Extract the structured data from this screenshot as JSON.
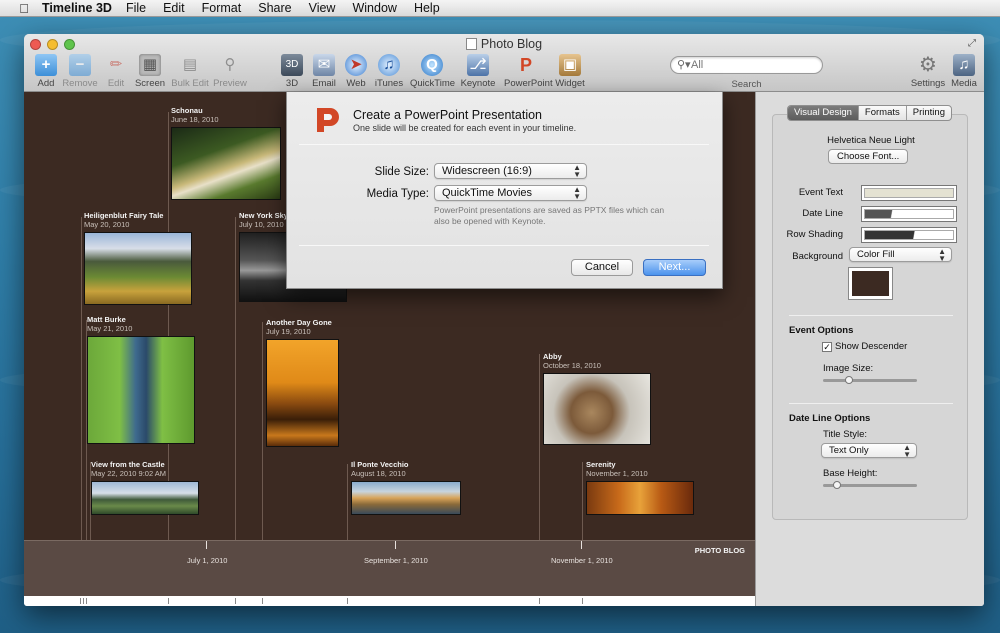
{
  "menubar": {
    "app_name": "Timeline 3D",
    "items": [
      "File",
      "Edit",
      "Format",
      "Share",
      "View",
      "Window",
      "Help"
    ]
  },
  "window": {
    "title": "Photo Blog"
  },
  "toolbar": {
    "buttons": [
      {
        "label": "Add",
        "icon": "plus-icon"
      },
      {
        "label": "Remove",
        "icon": "minus-icon"
      },
      {
        "label": "Edit",
        "icon": "pencil-icon"
      },
      {
        "label": "Screen",
        "icon": "screen-icon"
      },
      {
        "label": "Bulk Edit",
        "icon": "bulk-edit-icon"
      },
      {
        "label": "Preview",
        "icon": "preview-icon"
      },
      {
        "label": "3D",
        "icon": "3d-icon"
      },
      {
        "label": "Email",
        "icon": "email-icon"
      },
      {
        "label": "Web",
        "icon": "web-icon"
      },
      {
        "label": "iTunes",
        "icon": "itunes-icon"
      },
      {
        "label": "QuickTime",
        "icon": "quicktime-icon"
      },
      {
        "label": "Keynote",
        "icon": "keynote-icon"
      },
      {
        "label": "PowerPoint",
        "icon": "powerpoint-icon"
      },
      {
        "label": "Widget",
        "icon": "widget-icon"
      },
      {
        "label": "Settings",
        "icon": "settings-icon"
      },
      {
        "label": "Media",
        "icon": "media-icon"
      }
    ],
    "search": {
      "placeholder": "All",
      "label": "Search"
    }
  },
  "events": [
    {
      "title": "Schonau",
      "date": "June 18, 2010"
    },
    {
      "title": "Heiligenblut Fairy Tale",
      "date": "May 20, 2010"
    },
    {
      "title": "New York Skyl",
      "date": "July 10, 2010"
    },
    {
      "title": "Matt Burke",
      "date": "May 21, 2010"
    },
    {
      "title": "Another Day Gone",
      "date": "July 19, 2010"
    },
    {
      "title": "Abby",
      "date": "October 18, 2010"
    },
    {
      "title": "View from the Castle",
      "date": "May 22, 2010 9:02 AM"
    },
    {
      "title": "Il Ponte Vecchio",
      "date": "August 18, 2010"
    },
    {
      "title": "Serenity",
      "date": "November 1, 2010"
    }
  ],
  "timeline": {
    "labels": [
      "July 1, 2010",
      "September 1, 2010",
      "November 1, 2010"
    ],
    "brand": "PHOTO BLOG"
  },
  "dialog": {
    "title": "Create a PowerPoint Presentation",
    "subtitle": "One slide will be created for each event in your timeline.",
    "slide_size_label": "Slide Size:",
    "slide_size_value": "Widescreen (16:9)",
    "media_type_label": "Media Type:",
    "media_type_value": "QuickTime Movies",
    "note": "PowerPoint presentations are saved as PPTX files which can also be opened with Keynote.",
    "cancel": "Cancel",
    "next": "Next..."
  },
  "inspector": {
    "tabs": [
      "Visual Design",
      "Formats",
      "Printing"
    ],
    "active_tab": "Visual Design",
    "font_name": "Helvetica Neue Light",
    "choose_font": "Choose Font...",
    "event_text_label": "Event Text",
    "date_line_label": "Date Line",
    "row_shading_label": "Row Shading",
    "background_label": "Background",
    "background_value": "Color Fill",
    "event_options_header": "Event Options",
    "show_descender": "Show Descender",
    "show_descender_checked": true,
    "image_size_label": "Image Size:",
    "image_size": 0.35,
    "date_line_options_header": "Date Line Options",
    "title_style_label": "Title Style:",
    "title_style_value": "Text Only",
    "base_height_label": "Base Height:",
    "base_height": 0.15,
    "colors": {
      "event_text": "#e4e2d2",
      "background": "#3c2a22"
    }
  }
}
